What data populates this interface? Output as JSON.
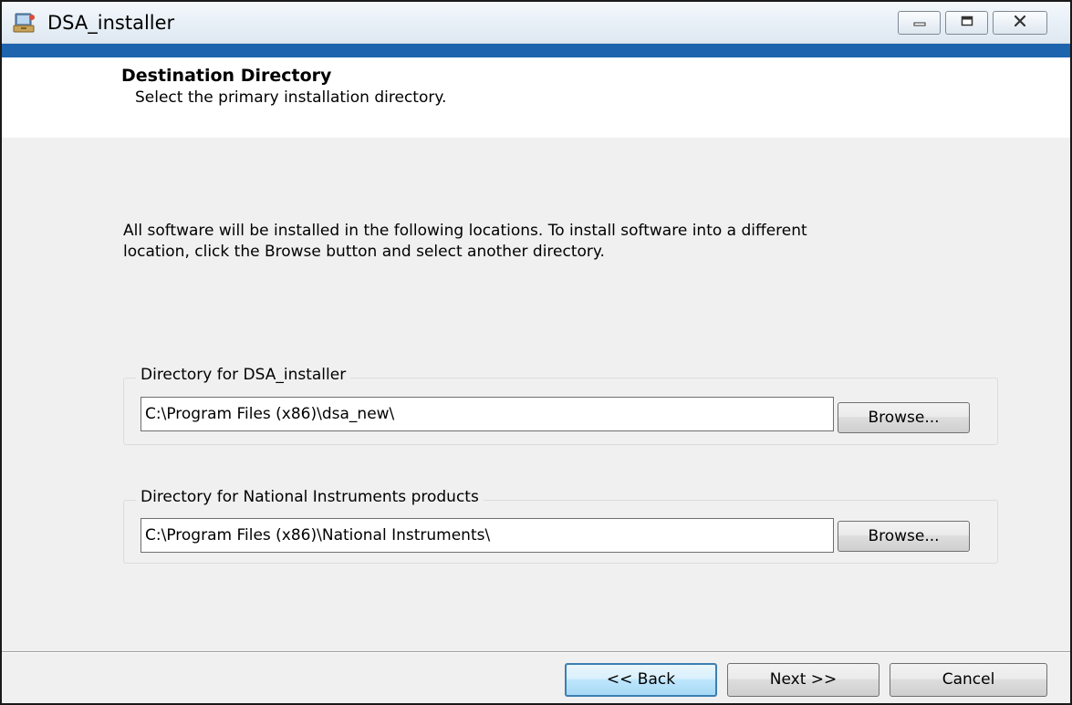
{
  "window": {
    "title": "DSA_installer",
    "icon": "installer-icon",
    "accent_color": "#1d63ad"
  },
  "header": {
    "title": "Destination Directory",
    "subtitle": "Select the primary installation directory."
  },
  "intro_text": "All software will be installed in the following locations. To install software into a different location, click the Browse button and select another directory.",
  "directories": [
    {
      "label": "Directory for DSA_installer",
      "path": "C:\\Program Files (x86)\\dsa_new\\",
      "browse_label": "Browse..."
    },
    {
      "label": "Directory for National Instruments products",
      "path": "C:\\Program Files (x86)\\National Instruments\\",
      "browse_label": "Browse..."
    }
  ],
  "footer": {
    "back_label": "<< Back",
    "next_label": "Next >>",
    "cancel_label": "Cancel"
  }
}
